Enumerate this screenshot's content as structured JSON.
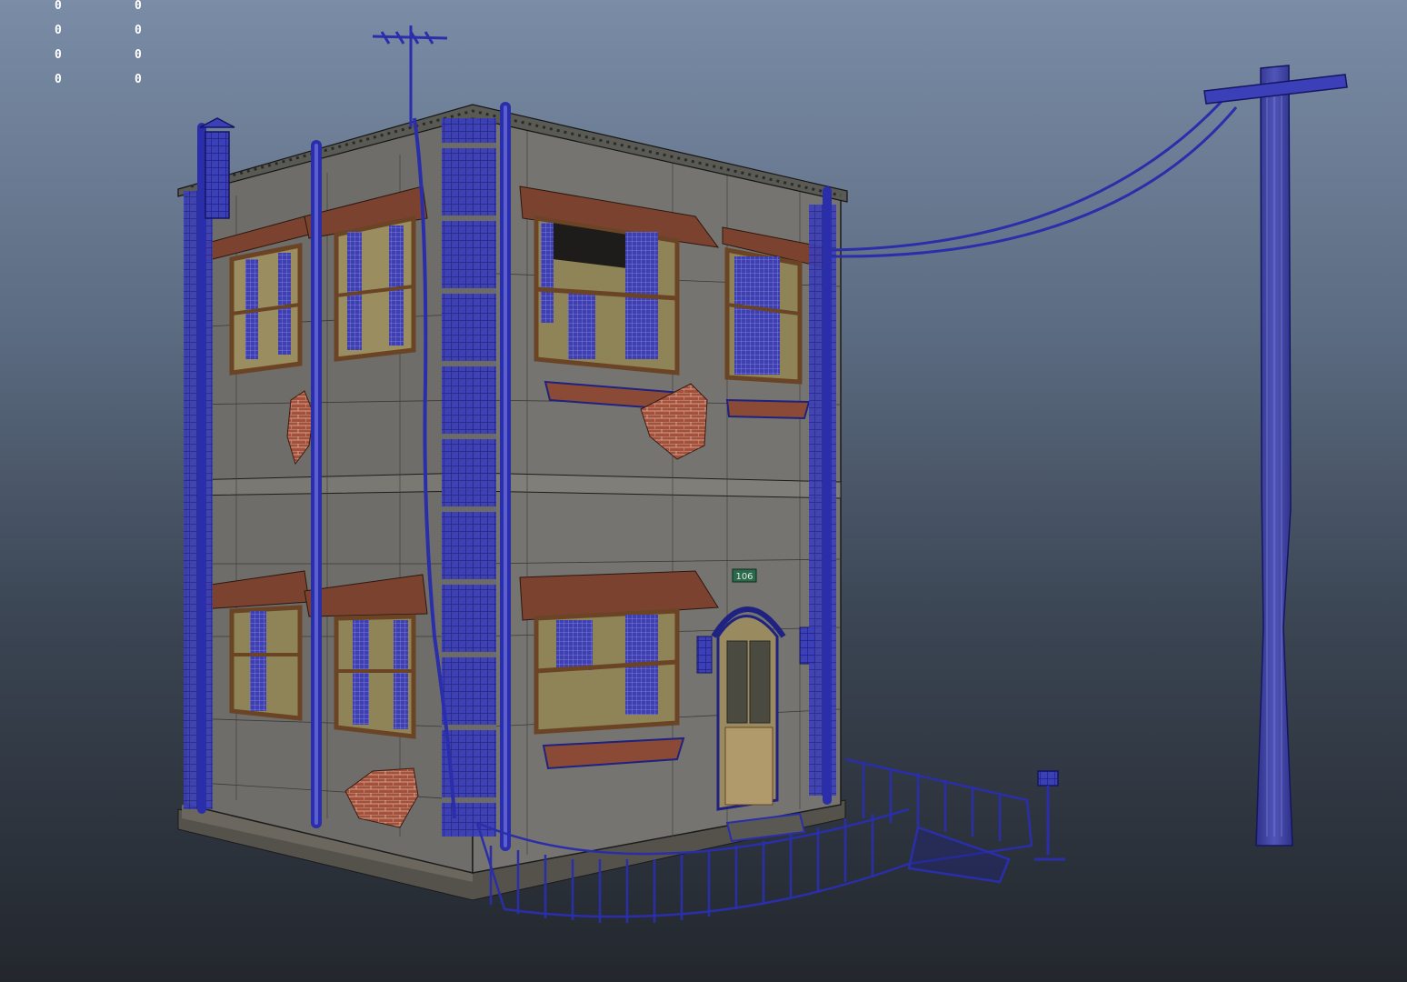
{
  "hud": {
    "left_values": [
      "0",
      "0",
      "0",
      "0"
    ],
    "right_values": [
      "0",
      "0",
      "0",
      "0"
    ]
  },
  "house_number": "106",
  "colors": {
    "wireframe": "#2b2f9c",
    "wall": "#6f6e69",
    "trim": "#5b4a3a",
    "awning": "#7a3f2c",
    "brick": "#9b4b35"
  }
}
